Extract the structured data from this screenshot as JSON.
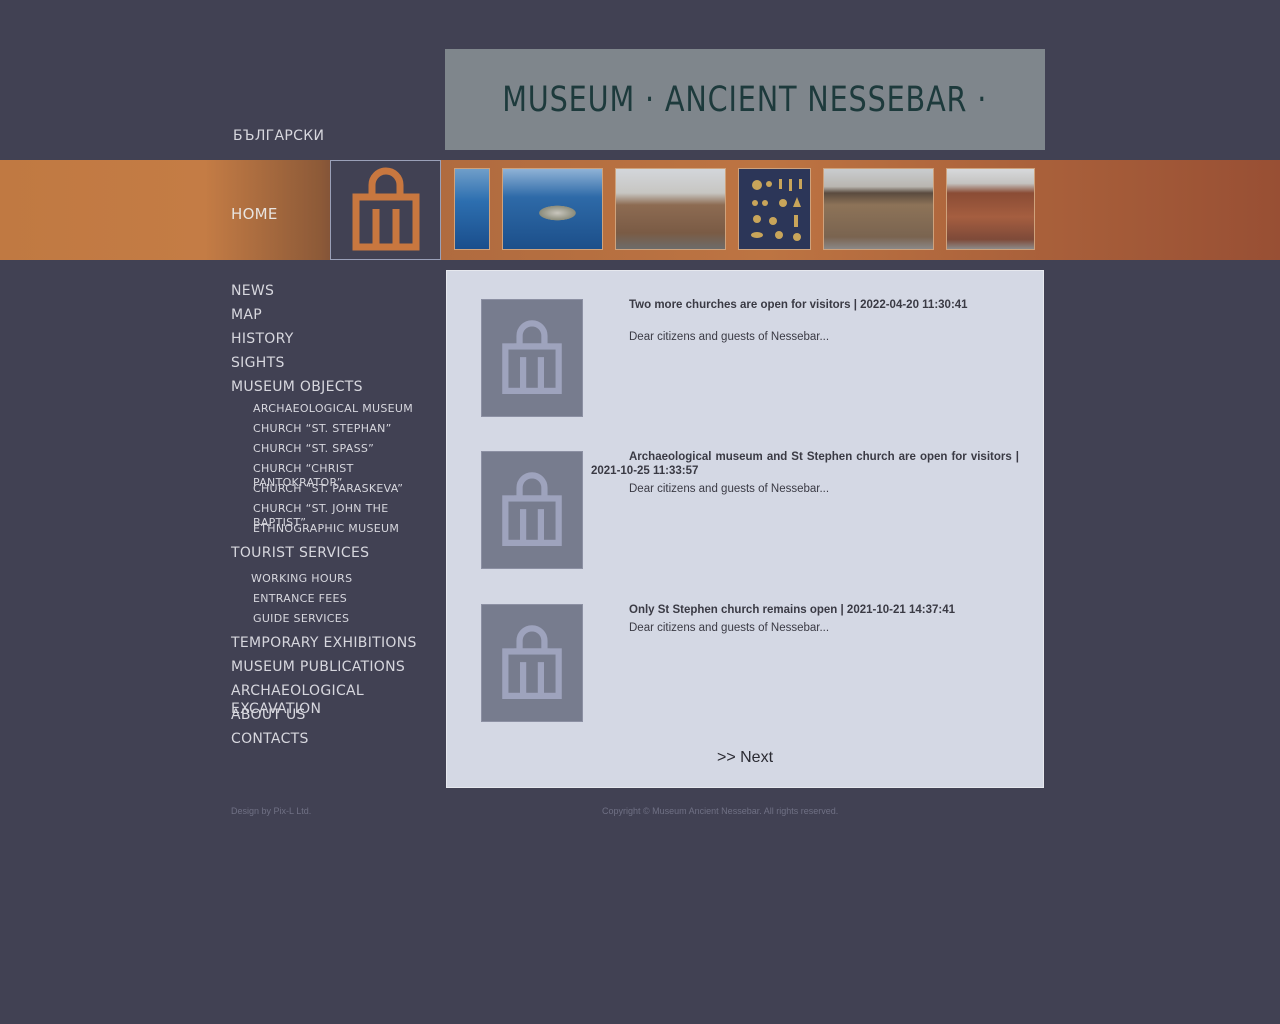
{
  "header": {
    "title": "MUSEUM · ANCIENT NESSEBAR ·",
    "language_link": "БЪЛГАРСКИ"
  },
  "strip": {
    "home_label": "HOME",
    "photos": [
      "photo-sea",
      "photo-aerial-island",
      "photo-church-stone",
      "photo-gold-objects",
      "photo-old-house",
      "photo-brick-church"
    ]
  },
  "nav": {
    "items": [
      {
        "label": "NEWS"
      },
      {
        "label": "MAP"
      },
      {
        "label": "HISTORY"
      },
      {
        "label": "SIGHTS"
      },
      {
        "label": "MUSEUM OBJECTS"
      }
    ],
    "museum_objects": [
      {
        "label": "ARCHAEOLOGICAL MUSEUM"
      },
      {
        "label": "CHURCH “ST. STEPHAN”"
      },
      {
        "label": "CHURCH “ST. SPASS”"
      },
      {
        "label": "CHURCH “CHRIST PANTOKRATOR”"
      },
      {
        "label": "CHURCH “ST. PARASKEVA”"
      },
      {
        "label": "CHURCH “ST. JOHN THE BAPTIST”"
      },
      {
        "label": "ETHNOGRAPHIC MUSEUM"
      }
    ],
    "tourist_services": {
      "label": "TOURIST SERVICES"
    },
    "tourist_sub": [
      {
        "label": "WORKING HOURS"
      },
      {
        "label": "ENTRANCE FEES"
      },
      {
        "label": "GUIDE SERVICES"
      }
    ],
    "bottom_items": [
      {
        "label": "TEMPORARY EXHIBITIONS"
      },
      {
        "label": "MUSEUM PUBLICATIONS"
      },
      {
        "label": "ARCHAEOLOGICAL EXCAVATION"
      },
      {
        "label": "ABOUT US"
      },
      {
        "label": "CONTACTS"
      }
    ]
  },
  "news": [
    {
      "title": "Two more churches are open for visitors | 2022-04-20 11:30:41",
      "text": "Dear citizens and guests of Nessebar..."
    },
    {
      "title": "Archaeological museum and St Stephen church are open for visitors | 2021-10-25 11:33:57",
      "text": "Dear citizens and guests of Nessebar..."
    },
    {
      "title": "Only St Stephen church remains open | 2021-10-21 14:37:41",
      "text": "Dear citizens and guests of Nessebar..."
    }
  ],
  "pagination": {
    "next_label": ">> Next"
  },
  "footer": {
    "design": "Design by Pix-L Ltd.",
    "copyright": "Copyright © Museum Ancient Nessebar. All rights reserved."
  },
  "colors": {
    "background": "#414153",
    "accent_orange": "#c07942",
    "banner": "#7f868c",
    "content_bg": "#d4d8e4"
  }
}
